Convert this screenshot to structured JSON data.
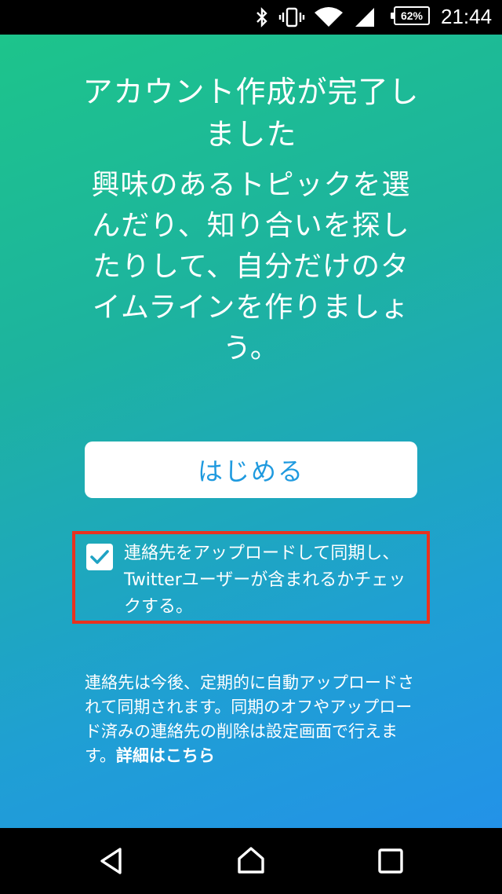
{
  "status_bar": {
    "battery_percent": "62%",
    "time": "21:44",
    "icons": [
      "bluetooth-icon",
      "vibrate-icon",
      "wifi-icon",
      "cell-signal-icon",
      "battery-icon"
    ]
  },
  "onboarding": {
    "title": "アカウント作成が完了しました",
    "subtitle": "興味のあるトピックを選んだり、知り合いを探したりして、自分だけのタイムラインを作りましょう。",
    "start_button_label": "はじめる",
    "sync_checkbox": {
      "checked": true,
      "label": "連絡先をアップロードして同期し、Twitterユーザーが含まれるかチェックする。"
    },
    "footnote_text": "連絡先は今後、定期的に自動アップロードされて同期されます。同期のオフやアップロード済みの連絡先の削除は設定画面で行えます。",
    "details_link": "詳細はこちら"
  },
  "colors": {
    "gradient_start": "#1dc48b",
    "gradient_end": "#2392e8",
    "button_text": "#1f9adf",
    "highlight_border": "#e8321f"
  },
  "nav_bar": {
    "icons": [
      "back-icon",
      "home-icon",
      "recents-icon"
    ]
  }
}
